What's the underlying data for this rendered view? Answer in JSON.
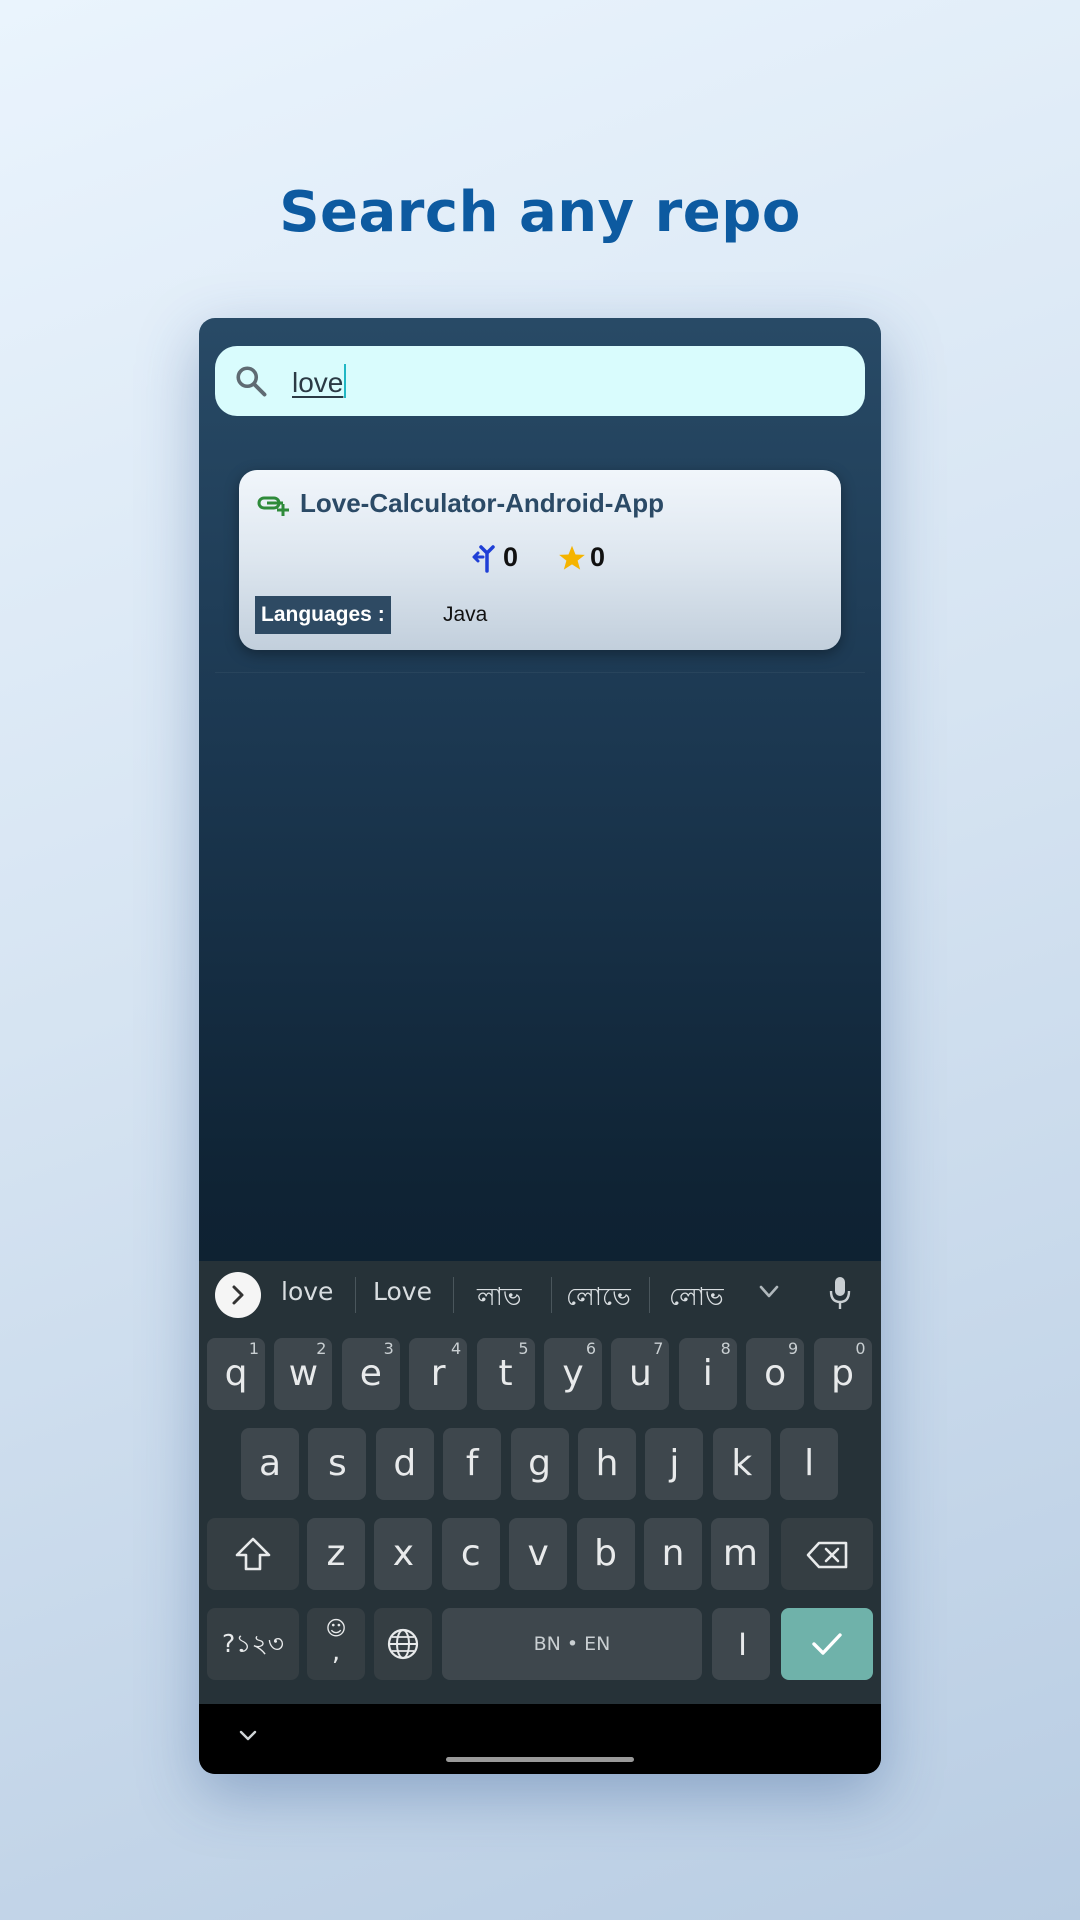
{
  "headline": "Search any repo",
  "search": {
    "query": "love",
    "icon": "search-icon"
  },
  "results": [
    {
      "name": "Love-Calculator-Android-App",
      "forks": "0",
      "stars": "0",
      "languages_label": "Languages :",
      "languages": "Java"
    }
  ],
  "keyboard": {
    "suggestions": [
      "love",
      "Love",
      "লাভ",
      "লোভে",
      "লোভ"
    ],
    "row1": [
      {
        "k": "q",
        "h": "1"
      },
      {
        "k": "w",
        "h": "2"
      },
      {
        "k": "e",
        "h": "3"
      },
      {
        "k": "r",
        "h": "4"
      },
      {
        "k": "t",
        "h": "5"
      },
      {
        "k": "y",
        "h": "6"
      },
      {
        "k": "u",
        "h": "7"
      },
      {
        "k": "i",
        "h": "8"
      },
      {
        "k": "o",
        "h": "9"
      },
      {
        "k": "p",
        "h": "0"
      }
    ],
    "row2": [
      "a",
      "s",
      "d",
      "f",
      "g",
      "h",
      "j",
      "k",
      "l"
    ],
    "row3": [
      "z",
      "x",
      "c",
      "v",
      "b",
      "n",
      "m"
    ],
    "symbols_label": "?১২৩",
    "emoji_label": "☺",
    "comma_label": ",",
    "space_label": "BN • EN",
    "danda_label": "।"
  },
  "colors": {
    "accent": "#0d5aa0",
    "enter_key": "#6fb2aa",
    "search_bg": "#d9fcfd",
    "star": "#f5b400",
    "fork": "#1f3fd6"
  }
}
